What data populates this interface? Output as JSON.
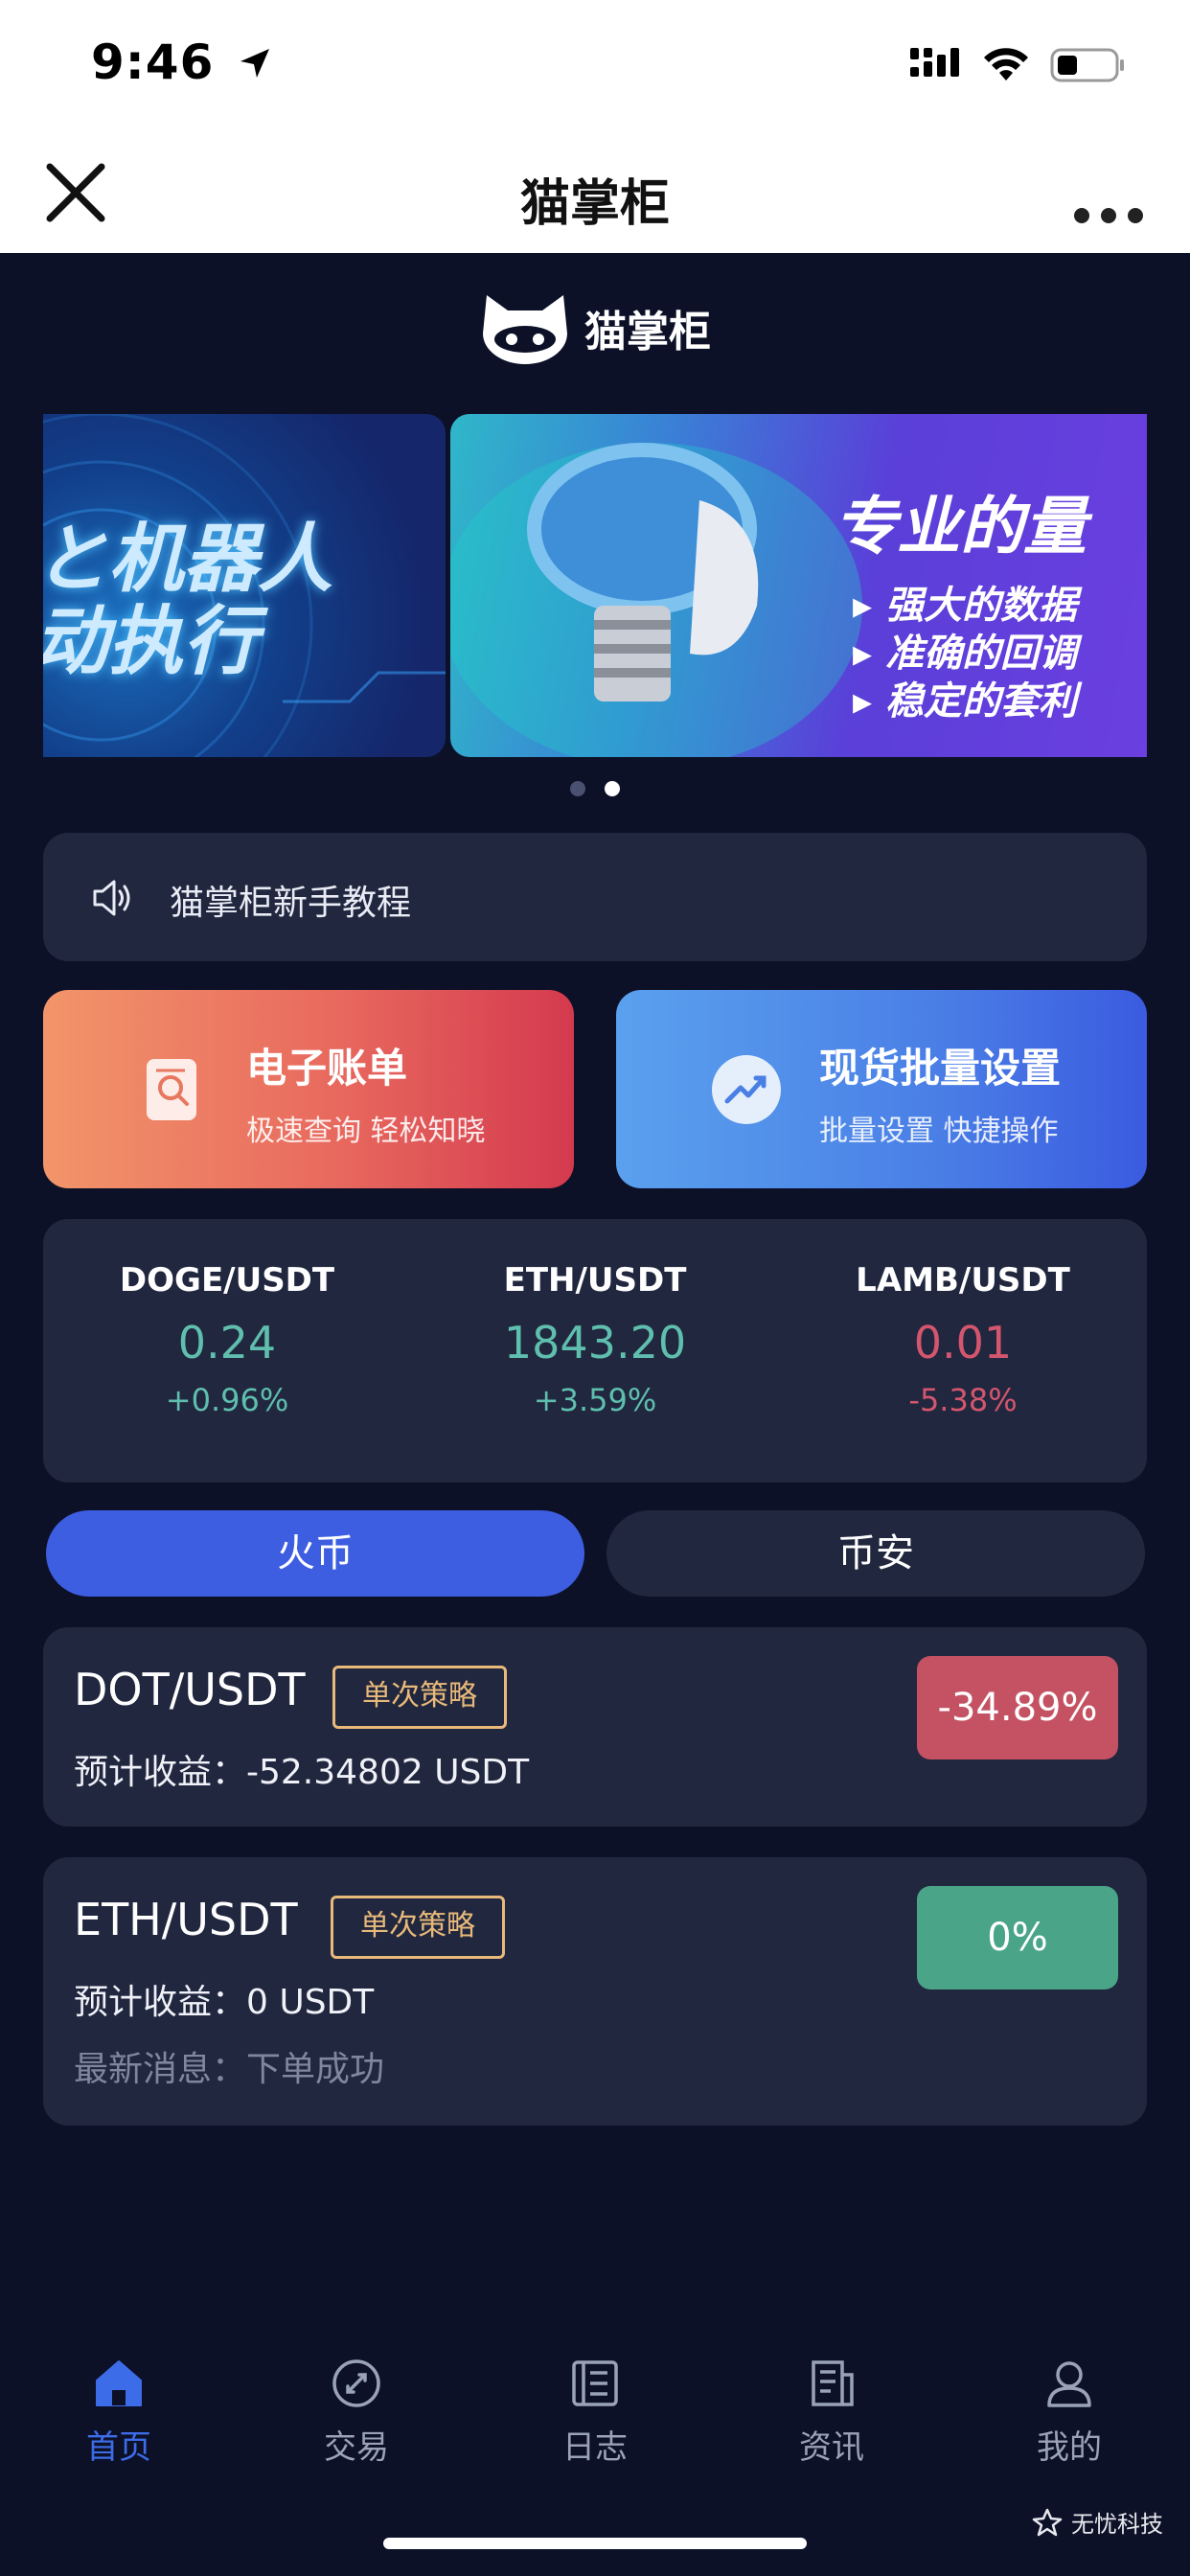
{
  "status_bar": {
    "time": "9:46"
  },
  "nav": {
    "title": "猫掌柜"
  },
  "brand": {
    "name": "猫掌柜"
  },
  "banner": {
    "left_lines": [
      "と机器人",
      "动执行"
    ],
    "right_headline": "专业的量",
    "right_bullets": [
      "▸ 强大的数据",
      "▸ 准确的回调",
      "▸ 稳定的套利"
    ]
  },
  "notice": {
    "text": "猫掌柜新手教程"
  },
  "cards": [
    {
      "title": "电子账单",
      "subtitle": "极速查询 轻松知晓"
    },
    {
      "title": "现货批量设置",
      "subtitle": "批量设置 快捷操作"
    }
  ],
  "tickers": [
    {
      "pair": "DOGE/USDT",
      "price": "0.24",
      "change": "+0.96%",
      "trend": "up"
    },
    {
      "pair": "ETH/USDT",
      "price": "1843.20",
      "change": "+3.59%",
      "trend": "up"
    },
    {
      "pair": "LAMB/USDT",
      "price": "0.01",
      "change": "-5.38%",
      "trend": "down"
    }
  ],
  "exchange_tabs": {
    "active": "火币",
    "inactive": "币安"
  },
  "positions": [
    {
      "pair": "DOT/USDT",
      "badge": "单次策略",
      "profit": "预计收益：-52.34802 USDT",
      "percent": "-34.89%"
    },
    {
      "pair": "ETH/USDT",
      "badge": "单次策略",
      "profit": "预计收益：0 USDT",
      "message": "最新消息：下单成功",
      "percent": "0%"
    }
  ],
  "tabbar": [
    "首页",
    "交易",
    "日志",
    "资讯",
    "我的"
  ],
  "watermark": "无忧科技",
  "colors": {
    "background": "#0c1128",
    "card": "#21273f",
    "accent": "#3d5ee0",
    "up": "#5fbfae",
    "down": "#d4566e",
    "badge": "#e8b97a"
  }
}
